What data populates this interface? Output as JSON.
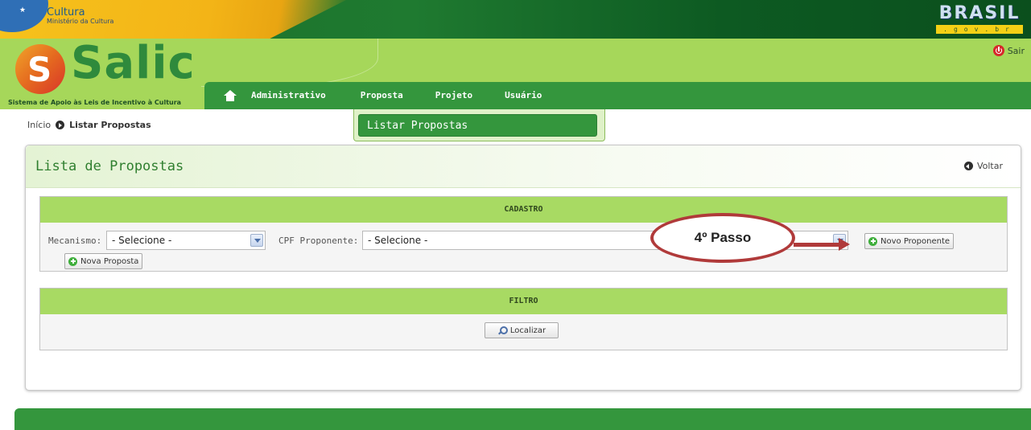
{
  "gov": {
    "ministry_title": "Cultura",
    "ministry_subtitle": "Ministério da Cultura",
    "brasil_logo": "BRASIL",
    "brasil_domain": ".gov.br"
  },
  "header": {
    "app_name": "Salic",
    "app_logo_letter": "S",
    "tagline": "Sistema de Apoio às Leis de Incentivo à Cultura",
    "logout_label": "Sair"
  },
  "nav": {
    "items": [
      {
        "label": "Administrativo"
      },
      {
        "label": "Proposta"
      },
      {
        "label": "Projeto"
      },
      {
        "label": "Usuário"
      }
    ],
    "dropdown": {
      "item": "Listar Propostas"
    }
  },
  "breadcrumb": {
    "home": "Início",
    "current": "Listar Propostas"
  },
  "panel": {
    "title": "Lista de Propostas",
    "back_label": "Voltar",
    "cadastro": {
      "heading": "CADASTRO",
      "mecanismo_label": "Mecanismo:",
      "mecanismo_value": "- Selecione -",
      "cpf_label": "CPF Proponente:",
      "cpf_value": "- Selecione -",
      "novo_proponente": "Novo Proponente",
      "nova_proposta": "Nova Proposta"
    },
    "filtro": {
      "heading": "FILTRO",
      "localizar": "Localizar"
    }
  },
  "annotation": {
    "text": "4º Passo"
  },
  "colors": {
    "dark_green": "#34963d",
    "light_green": "#a6d75a",
    "section_green": "#a8da63",
    "annotation_red": "#b03a3a"
  }
}
